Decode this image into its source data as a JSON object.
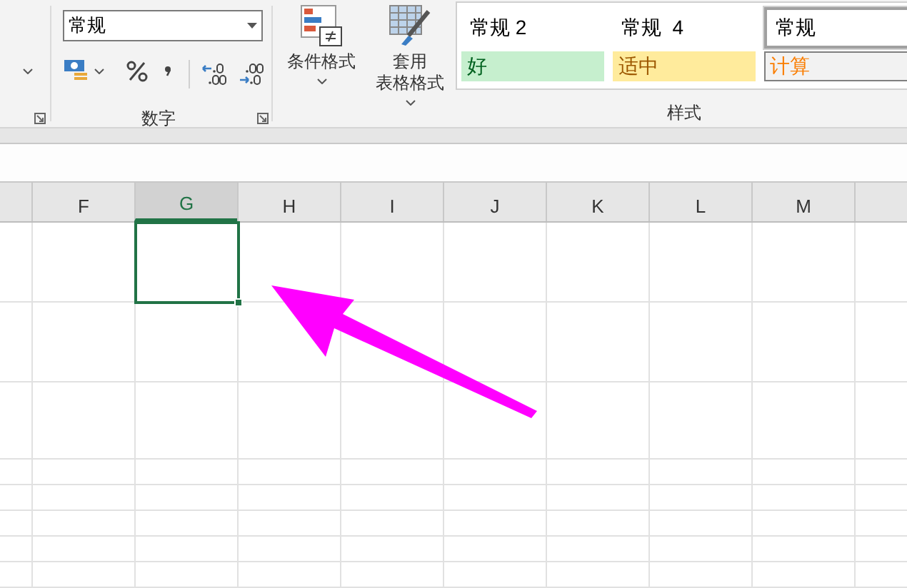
{
  "ribbon": {
    "number_group": {
      "format_dropdown": {
        "value": "常规"
      },
      "label": "数字"
    },
    "buttons": [
      {
        "lines": [
          "条件格式"
        ],
        "kind": "conditional"
      },
      {
        "lines": [
          "套用",
          "表格格式"
        ],
        "kind": "table"
      }
    ],
    "styles_group": {
      "label": "样式",
      "styles": [
        {
          "label": "常规 2",
          "kind": "plain",
          "selected": false
        },
        {
          "label": "常规  4",
          "kind": "plain",
          "selected": false
        },
        {
          "label": "常规",
          "kind": "plain",
          "selected": true
        },
        {
          "label": "好",
          "kind": "good",
          "selected": false
        },
        {
          "label": "适中",
          "kind": "neutral",
          "selected": false
        },
        {
          "label": "计算",
          "kind": "calc",
          "selected": false
        }
      ]
    }
  },
  "sheet": {
    "columns": [
      {
        "label": "F",
        "selected": false
      },
      {
        "label": "G",
        "selected": true
      },
      {
        "label": "H",
        "selected": false
      },
      {
        "label": "I",
        "selected": false
      },
      {
        "label": "J",
        "selected": false
      },
      {
        "label": "K",
        "selected": false
      },
      {
        "label": "L",
        "selected": false
      },
      {
        "label": "M",
        "selected": false
      }
    ]
  }
}
